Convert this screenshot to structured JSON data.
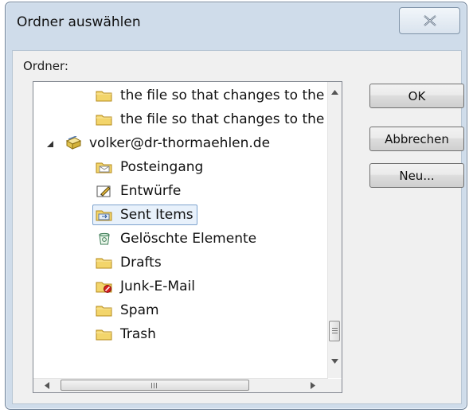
{
  "window": {
    "title": "Ordner auswählen",
    "close_icon": "close-x-icon"
  },
  "dialog": {
    "folders_label": "Ordner:"
  },
  "tree": {
    "items": [
      {
        "label": "the file so that changes to the",
        "icon": "folder-icon",
        "level": 2
      },
      {
        "label": "the file so that changes to the",
        "icon": "folder-icon",
        "level": 2
      },
      {
        "label": "volker@dr-thormaehlen.de",
        "icon": "mailbox-icon",
        "level": 1,
        "expanded": true
      },
      {
        "label": "Posteingang",
        "icon": "inbox-folder-icon",
        "level": 2
      },
      {
        "label": "Entwürfe",
        "icon": "drafts-folder-icon",
        "level": 2
      },
      {
        "label": "Sent Items",
        "icon": "sent-folder-icon",
        "level": 2,
        "selected": true
      },
      {
        "label": "Gelöschte Elemente",
        "icon": "deleted-items-icon",
        "level": 2
      },
      {
        "label": "Drafts",
        "icon": "folder-icon",
        "level": 2
      },
      {
        "label": "Junk-E-Mail",
        "icon": "junk-folder-icon",
        "level": 2
      },
      {
        "label": "Spam",
        "icon": "folder-icon",
        "level": 2
      },
      {
        "label": "Trash",
        "icon": "folder-icon",
        "level": 2
      }
    ]
  },
  "buttons": {
    "ok": "OK",
    "cancel": "Abbrechen",
    "new": "Neu..."
  },
  "colors": {
    "window_frame": "#cfdcea",
    "selection_border": "#7da2ce",
    "selection_fill": "#e8f1fb",
    "folder_yellow": "#f3d56b"
  }
}
